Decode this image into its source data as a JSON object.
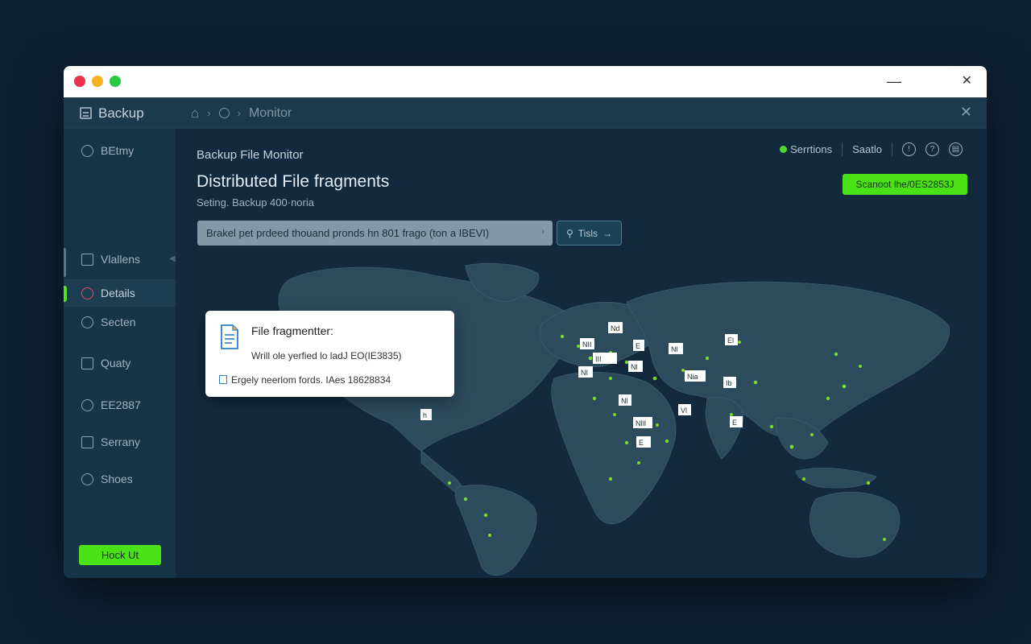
{
  "app": {
    "brand": "Backup",
    "breadcrumb": {
      "current": "Monitor"
    }
  },
  "sidebar": {
    "items": [
      {
        "label": "BEtmy",
        "icon": "globe-icon"
      },
      {
        "label": "Vlallens",
        "icon": "bars-icon"
      },
      {
        "label": "Details",
        "icon": "target-icon",
        "active": true
      },
      {
        "label": "Secten",
        "icon": "clock-icon"
      },
      {
        "label": "Quaty",
        "icon": "grid-icon"
      },
      {
        "label": "EE2887",
        "icon": "users-icon"
      },
      {
        "label": "Serrany",
        "icon": "table-icon"
      },
      {
        "label": "Shoes",
        "icon": "hand-icon"
      }
    ],
    "lock_button": "Hock Ut"
  },
  "main": {
    "section_label": "Backup File Monitor",
    "title": "Distributed File fragments",
    "subtitle": "Seting. Backup 400·noria",
    "status": {
      "label": "Serrtions",
      "user": "Saatlo"
    },
    "status_button": "Scanoot lhe/0ES2853J",
    "search": {
      "value": "Brakel pet prdeed thouand pronds hn 801 frago (ton a IBEVI)",
      "button": "Tisls"
    }
  },
  "popup": {
    "title": "File fragmentter:",
    "line1": "Wrill ole yerfied lo ladJ EO(IE3835)",
    "line2": "Ergely neerlom fords. IAes 18628834"
  },
  "map_labels": [
    "Nd",
    "NII",
    "E",
    "Nl",
    "III",
    "El",
    "NI",
    "Nia",
    "Nl",
    "Ib",
    "Nl",
    "Vl",
    "E",
    "NIll",
    "E",
    "h"
  ],
  "colors": {
    "accent": "#4ae117",
    "background": "#0f2235"
  }
}
